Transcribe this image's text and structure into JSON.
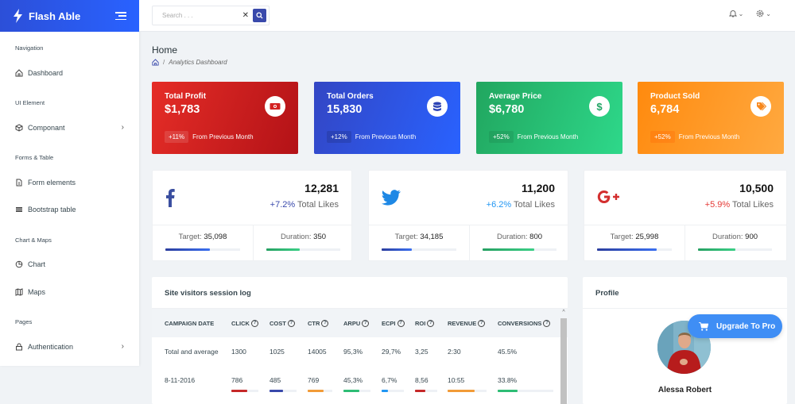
{
  "brand": {
    "name": "Flash Able"
  },
  "search": {
    "placeholder": "Search . . ."
  },
  "sidebar": {
    "groups": [
      {
        "caption": "Navigation",
        "items": [
          {
            "label": "Dashboard",
            "icon": "home-icon"
          }
        ]
      },
      {
        "caption": "UI Element",
        "items": [
          {
            "label": "Componant",
            "icon": "box-icon",
            "has_submenu": true
          }
        ]
      },
      {
        "caption": "Forms & Table",
        "items": [
          {
            "label": "Form elements",
            "icon": "file-text-icon"
          },
          {
            "label": "Bootstrap table",
            "icon": "table-icon"
          }
        ]
      },
      {
        "caption": "Chart & Maps",
        "items": [
          {
            "label": "Chart",
            "icon": "pie-chart-icon"
          },
          {
            "label": "Maps",
            "icon": "map-icon"
          }
        ]
      },
      {
        "caption": "Pages",
        "items": [
          {
            "label": "Authentication",
            "icon": "lock-icon",
            "has_submenu": true
          }
        ]
      }
    ]
  },
  "header": {
    "title": "Home",
    "breadcrumb": [
      "Analytics Dashboard"
    ]
  },
  "stats": [
    {
      "title": "Total Profit",
      "value": "$1,783",
      "change": "+11%",
      "note": "From Previous Month",
      "icon": "money-icon",
      "color": "#e52d27"
    },
    {
      "title": "Total Orders",
      "value": "15,830",
      "change": "+12%",
      "note": "From Previous Month",
      "icon": "database-icon",
      "color": "#2962ff"
    },
    {
      "title": "Average Price",
      "value": "$6,780",
      "change": "+52%",
      "note": "From Previous Month",
      "icon": "dollar-icon",
      "color": "#2ed8a3"
    },
    {
      "title": "Product Sold",
      "value": "6,784",
      "change": "+52%",
      "note": "From Previous Month",
      "icon": "tags-icon",
      "color": "#ffa726"
    }
  ],
  "social": [
    {
      "network": "facebook",
      "icon": "facebook-icon",
      "count": "12,281",
      "change": "+7.2%",
      "likes_label": "Total Likes",
      "change_color": "#3949ab",
      "target_label": "Target:",
      "target": "35,098",
      "target_progress": 0.6,
      "duration_label": "Duration:",
      "duration": "350",
      "duration_progress": 0.45
    },
    {
      "network": "twitter",
      "icon": "twitter-icon",
      "count": "11,200",
      "change": "+6.2%",
      "likes_label": "Total Likes",
      "change_color": "#2196f3",
      "target_label": "Target:",
      "target": "34,185",
      "target_progress": 0.4,
      "duration_label": "Duration:",
      "duration": "800",
      "duration_progress": 0.7
    },
    {
      "network": "google-plus",
      "icon": "google-plus-icon",
      "count": "10,500",
      "change": "+5.9%",
      "likes_label": "Total Likes",
      "change_color": "#e53935",
      "target_label": "Target:",
      "target": "25,998",
      "target_progress": 0.8,
      "duration_label": "Duration:",
      "duration": "900",
      "duration_progress": 0.5
    }
  ],
  "session_log": {
    "title": "Site visitors session log",
    "columns": [
      "CAMPAIGN DATE",
      "CLICK",
      "COST",
      "CTR",
      "ARPU",
      "ECPI",
      "ROI",
      "REVENUE",
      "CONVERSIONS"
    ],
    "rows": [
      {
        "cells": [
          "Total and average",
          "1300",
          "1025",
          "14005",
          "95,3%",
          "29,7%",
          "3,25",
          "2:30",
          "45.5%"
        ]
      },
      {
        "cells": [
          "8-11-2016",
          "786",
          "485",
          "769",
          "45,3%",
          "6,7%",
          "8,56",
          "10:55",
          "33.8%"
        ],
        "bars": [
          null,
          0.6,
          0.5,
          0.65,
          0.6,
          0.3,
          0.45,
          0.7,
          0.35
        ],
        "bar_colors": [
          null,
          "#c62828",
          "#3949ab",
          "#f29b38",
          "#2ebd75",
          "#2196f3",
          "#c62828",
          "#f29b38",
          "#2ebd75"
        ]
      }
    ]
  },
  "profile": {
    "title": "Profile",
    "name": "Alessa Robert"
  },
  "upgrade": {
    "label": "Upgrade To Pro"
  }
}
